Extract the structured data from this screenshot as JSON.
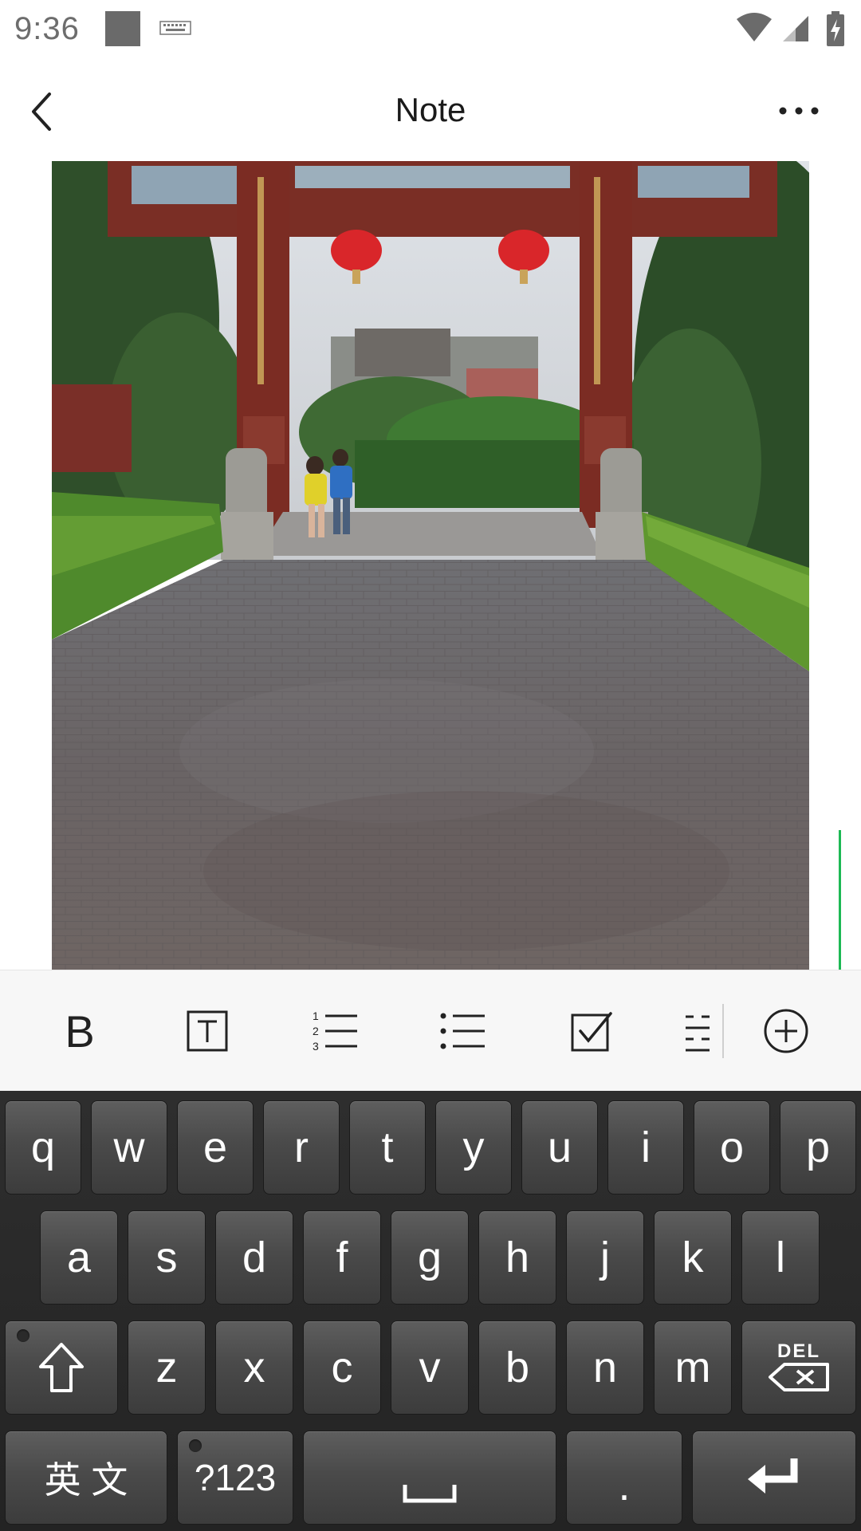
{
  "status_bar": {
    "time": "9:36",
    "notification_icon": "square-notification-icon",
    "keyboard_icon": "keyboard-icon",
    "wifi_icon": "wifi-icon",
    "signal_icon": "cell-signal-icon",
    "battery_icon": "battery-charging-icon"
  },
  "header": {
    "title": "Note",
    "back_icon": "chevron-left-icon",
    "more_icon": "more-horizontal-icon"
  },
  "content": {
    "image_description_icon": "photo-icon",
    "cursor_color": "#1db954"
  },
  "format_toolbar": {
    "bold_label": "B",
    "items": [
      "bold",
      "text-style",
      "numbered-list",
      "bulleted-list",
      "checklist",
      "indent",
      "insert"
    ]
  },
  "keyboard": {
    "row1": [
      "q",
      "w",
      "e",
      "r",
      "t",
      "y",
      "u",
      "i",
      "o",
      "p"
    ],
    "row2": [
      "a",
      "s",
      "d",
      "f",
      "g",
      "h",
      "j",
      "k",
      "l"
    ],
    "row3": [
      "z",
      "x",
      "c",
      "v",
      "b",
      "n",
      "m"
    ],
    "del_label": "DEL",
    "lang_label": "英 文",
    "symbols_label": "?123",
    "period_label": "."
  }
}
